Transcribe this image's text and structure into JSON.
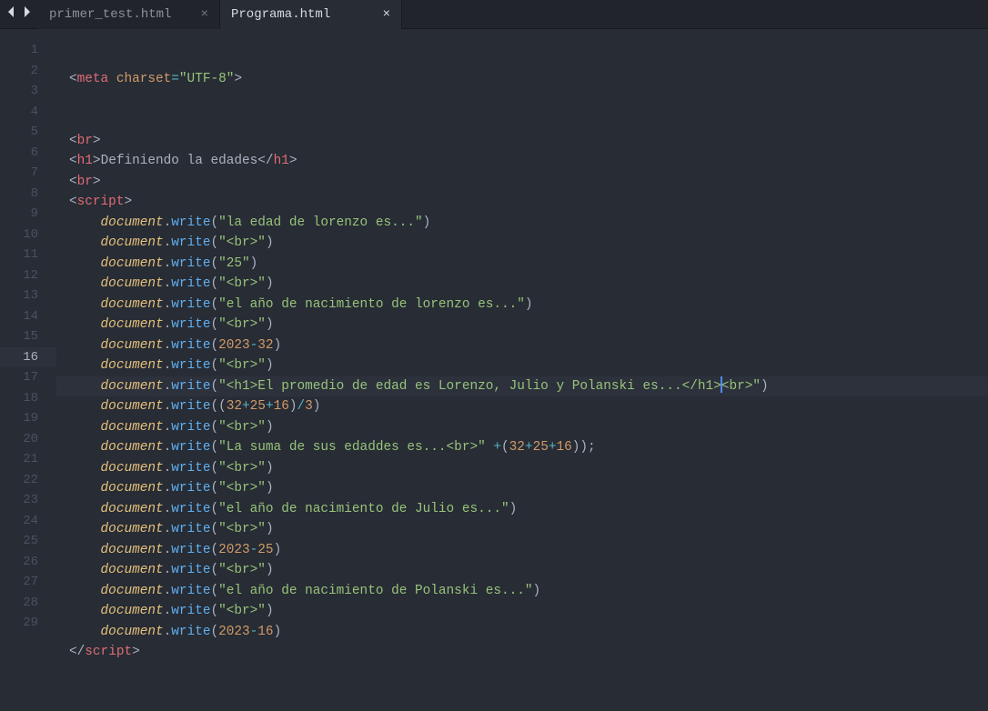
{
  "tabs": {
    "items": [
      {
        "label": "primer_test.html",
        "active": false
      },
      {
        "label": "Programa.html",
        "active": true
      }
    ]
  },
  "editor": {
    "currentLine": 16,
    "cursorCol": 92,
    "lines": [
      {
        "n": 1,
        "segs": [
          [
            "punc",
            "<"
          ],
          [
            "tagname",
            "meta"
          ],
          [
            "punc",
            " "
          ],
          [
            "attr",
            "charset"
          ],
          [
            "op",
            "="
          ],
          [
            "str",
            "\"UTF-8\""
          ],
          [
            "punc",
            ">"
          ]
        ]
      },
      {
        "n": 2,
        "segs": []
      },
      {
        "n": 3,
        "segs": []
      },
      {
        "n": 4,
        "segs": [
          [
            "punc",
            "<"
          ],
          [
            "tagname",
            "br"
          ],
          [
            "punc",
            ">"
          ]
        ]
      },
      {
        "n": 5,
        "segs": [
          [
            "punc",
            "<"
          ],
          [
            "tagname",
            "h1"
          ],
          [
            "punc",
            ">"
          ],
          [
            "punc",
            "Definiendo la edades"
          ],
          [
            "punc",
            "</"
          ],
          [
            "tagname",
            "h1"
          ],
          [
            "punc",
            ">"
          ]
        ]
      },
      {
        "n": 6,
        "segs": [
          [
            "punc",
            "<"
          ],
          [
            "tagname",
            "br"
          ],
          [
            "punc",
            ">"
          ]
        ]
      },
      {
        "n": 7,
        "segs": [
          [
            "punc",
            "<"
          ],
          [
            "tagname",
            "script"
          ],
          [
            "punc",
            ">"
          ]
        ]
      },
      {
        "n": 8,
        "segs": [
          [
            "punc",
            "    "
          ],
          [
            "obj",
            "document"
          ],
          [
            "punc",
            "."
          ],
          [
            "method",
            "write"
          ],
          [
            "punc",
            "("
          ],
          [
            "str",
            "\"la edad de lorenzo es...\""
          ],
          [
            "punc",
            ")"
          ]
        ]
      },
      {
        "n": 9,
        "segs": [
          [
            "punc",
            "    "
          ],
          [
            "obj",
            "document"
          ],
          [
            "punc",
            "."
          ],
          [
            "method",
            "write"
          ],
          [
            "punc",
            "("
          ],
          [
            "str",
            "\"<br>\""
          ],
          [
            "punc",
            ")"
          ]
        ]
      },
      {
        "n": 10,
        "segs": [
          [
            "punc",
            "    "
          ],
          [
            "obj",
            "document"
          ],
          [
            "punc",
            "."
          ],
          [
            "method",
            "write"
          ],
          [
            "punc",
            "("
          ],
          [
            "str",
            "\"25\""
          ],
          [
            "punc",
            ")"
          ]
        ]
      },
      {
        "n": 11,
        "segs": [
          [
            "punc",
            "    "
          ],
          [
            "obj",
            "document"
          ],
          [
            "punc",
            "."
          ],
          [
            "method",
            "write"
          ],
          [
            "punc",
            "("
          ],
          [
            "str",
            "\"<br>\""
          ],
          [
            "punc",
            ")"
          ]
        ]
      },
      {
        "n": 12,
        "segs": [
          [
            "punc",
            "    "
          ],
          [
            "obj",
            "document"
          ],
          [
            "punc",
            "."
          ],
          [
            "method",
            "write"
          ],
          [
            "punc",
            "("
          ],
          [
            "str",
            "\"el año de nacimiento de lorenzo es...\""
          ],
          [
            "punc",
            ")"
          ]
        ]
      },
      {
        "n": 13,
        "segs": [
          [
            "punc",
            "    "
          ],
          [
            "obj",
            "document"
          ],
          [
            "punc",
            "."
          ],
          [
            "method",
            "write"
          ],
          [
            "punc",
            "("
          ],
          [
            "str",
            "\"<br>\""
          ],
          [
            "punc",
            ")"
          ]
        ]
      },
      {
        "n": 14,
        "segs": [
          [
            "punc",
            "    "
          ],
          [
            "obj",
            "document"
          ],
          [
            "punc",
            "."
          ],
          [
            "method",
            "write"
          ],
          [
            "punc",
            "("
          ],
          [
            "attr",
            "2023"
          ],
          [
            "op",
            "-"
          ],
          [
            "attr",
            "32"
          ],
          [
            "punc",
            ")"
          ]
        ]
      },
      {
        "n": 15,
        "segs": [
          [
            "punc",
            "    "
          ],
          [
            "obj",
            "document"
          ],
          [
            "punc",
            "."
          ],
          [
            "method",
            "write"
          ],
          [
            "punc",
            "("
          ],
          [
            "str",
            "\"<br>\""
          ],
          [
            "punc",
            ")"
          ]
        ]
      },
      {
        "n": 16,
        "segs": [
          [
            "punc",
            "    "
          ],
          [
            "obj",
            "document"
          ],
          [
            "punc",
            "."
          ],
          [
            "method",
            "write"
          ],
          [
            "punc",
            "("
          ],
          [
            "str",
            "\"<h1>El promedio de edad es Lorenzo, Julio y Polanski es...</h1>"
          ],
          [
            "cursor",
            ""
          ],
          [
            "str",
            "<br>\""
          ],
          [
            "punc",
            ")"
          ]
        ]
      },
      {
        "n": 17,
        "segs": [
          [
            "punc",
            "    "
          ],
          [
            "obj",
            "document"
          ],
          [
            "punc",
            "."
          ],
          [
            "method",
            "write"
          ],
          [
            "punc",
            "(("
          ],
          [
            "attr",
            "32"
          ],
          [
            "op",
            "+"
          ],
          [
            "attr",
            "25"
          ],
          [
            "op",
            "+"
          ],
          [
            "attr",
            "16"
          ],
          [
            "punc",
            ")"
          ],
          [
            "op",
            "/"
          ],
          [
            "attr",
            "3"
          ],
          [
            "punc",
            ")"
          ]
        ]
      },
      {
        "n": 18,
        "segs": [
          [
            "punc",
            "    "
          ],
          [
            "obj",
            "document"
          ],
          [
            "punc",
            "."
          ],
          [
            "method",
            "write"
          ],
          [
            "punc",
            "("
          ],
          [
            "str",
            "\"<br>\""
          ],
          [
            "punc",
            ")"
          ]
        ]
      },
      {
        "n": 19,
        "segs": [
          [
            "punc",
            "    "
          ],
          [
            "obj",
            "document"
          ],
          [
            "punc",
            "."
          ],
          [
            "method",
            "write"
          ],
          [
            "punc",
            "("
          ],
          [
            "str",
            "\"La suma de sus edaddes es...<br>\""
          ],
          [
            "punc",
            " "
          ],
          [
            "op",
            "+"
          ],
          [
            "punc",
            "("
          ],
          [
            "attr",
            "32"
          ],
          [
            "op",
            "+"
          ],
          [
            "attr",
            "25"
          ],
          [
            "op",
            "+"
          ],
          [
            "attr",
            "16"
          ],
          [
            "punc",
            "));"
          ]
        ]
      },
      {
        "n": 20,
        "segs": [
          [
            "punc",
            "    "
          ],
          [
            "obj",
            "document"
          ],
          [
            "punc",
            "."
          ],
          [
            "method",
            "write"
          ],
          [
            "punc",
            "("
          ],
          [
            "str",
            "\"<br>\""
          ],
          [
            "punc",
            ")"
          ]
        ]
      },
      {
        "n": 21,
        "segs": [
          [
            "punc",
            "    "
          ],
          [
            "obj",
            "document"
          ],
          [
            "punc",
            "."
          ],
          [
            "method",
            "write"
          ],
          [
            "punc",
            "("
          ],
          [
            "str",
            "\"<br>\""
          ],
          [
            "punc",
            ")"
          ]
        ]
      },
      {
        "n": 22,
        "segs": [
          [
            "punc",
            "    "
          ],
          [
            "obj",
            "document"
          ],
          [
            "punc",
            "."
          ],
          [
            "method",
            "write"
          ],
          [
            "punc",
            "("
          ],
          [
            "str",
            "\"el año de nacimiento de Julio es...\""
          ],
          [
            "punc",
            ")"
          ]
        ]
      },
      {
        "n": 23,
        "segs": [
          [
            "punc",
            "    "
          ],
          [
            "obj",
            "document"
          ],
          [
            "punc",
            "."
          ],
          [
            "method",
            "write"
          ],
          [
            "punc",
            "("
          ],
          [
            "str",
            "\"<br>\""
          ],
          [
            "punc",
            ")"
          ]
        ]
      },
      {
        "n": 24,
        "segs": [
          [
            "punc",
            "    "
          ],
          [
            "obj",
            "document"
          ],
          [
            "punc",
            "."
          ],
          [
            "method",
            "write"
          ],
          [
            "punc",
            "("
          ],
          [
            "attr",
            "2023"
          ],
          [
            "op",
            "-"
          ],
          [
            "attr",
            "25"
          ],
          [
            "punc",
            ")"
          ]
        ]
      },
      {
        "n": 25,
        "segs": [
          [
            "punc",
            "    "
          ],
          [
            "obj",
            "document"
          ],
          [
            "punc",
            "."
          ],
          [
            "method",
            "write"
          ],
          [
            "punc",
            "("
          ],
          [
            "str",
            "\"<br>\""
          ],
          [
            "punc",
            ")"
          ]
        ]
      },
      {
        "n": 26,
        "segs": [
          [
            "punc",
            "    "
          ],
          [
            "obj",
            "document"
          ],
          [
            "punc",
            "."
          ],
          [
            "method",
            "write"
          ],
          [
            "punc",
            "("
          ],
          [
            "str",
            "\"el año de nacimiento de Polanski es...\""
          ],
          [
            "punc",
            ")"
          ]
        ]
      },
      {
        "n": 27,
        "segs": [
          [
            "punc",
            "    "
          ],
          [
            "obj",
            "document"
          ],
          [
            "punc",
            "."
          ],
          [
            "method",
            "write"
          ],
          [
            "punc",
            "("
          ],
          [
            "str",
            "\"<br>\""
          ],
          [
            "punc",
            ")"
          ]
        ]
      },
      {
        "n": 28,
        "segs": [
          [
            "punc",
            "    "
          ],
          [
            "obj",
            "document"
          ],
          [
            "punc",
            "."
          ],
          [
            "method",
            "write"
          ],
          [
            "punc",
            "("
          ],
          [
            "attr",
            "2023"
          ],
          [
            "op",
            "-"
          ],
          [
            "attr",
            "16"
          ],
          [
            "punc",
            ")"
          ]
        ]
      },
      {
        "n": 29,
        "segs": [
          [
            "punc",
            "</"
          ],
          [
            "tagname",
            "script"
          ],
          [
            "punc",
            ">"
          ]
        ]
      }
    ]
  }
}
